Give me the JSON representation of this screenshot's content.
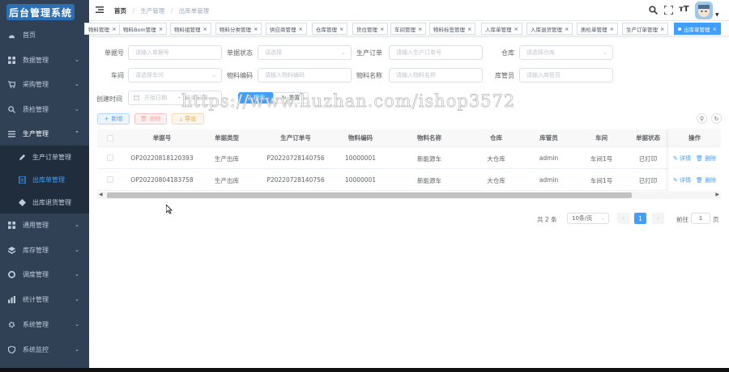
{
  "logo": "后台管理系统",
  "sidebar": {
    "items": [
      {
        "label": "首页",
        "icon": "dashboard-icon"
      },
      {
        "label": "数据管理",
        "icon": "grid-icon"
      },
      {
        "label": "采购管理",
        "icon": "cart-icon"
      },
      {
        "label": "质检管理",
        "icon": "search-icon"
      },
      {
        "label": "生产管理",
        "icon": "list-icon"
      }
    ],
    "sub_items": [
      {
        "label": "生产订单管理",
        "icon": "edit-icon"
      },
      {
        "label": "出库单管理",
        "icon": "doc-icon"
      },
      {
        "label": "出库退货管理",
        "icon": "return-icon"
      }
    ],
    "bottom_items": [
      {
        "label": "通用管理",
        "icon": "grid-icon"
      },
      {
        "label": "库存管理",
        "icon": "box-icon"
      },
      {
        "label": "调度管理",
        "icon": "gear-icon"
      },
      {
        "label": "统计管理",
        "icon": "chart-icon"
      },
      {
        "label": "系统管理",
        "icon": "cog-icon"
      },
      {
        "label": "系统监控",
        "icon": "shield-icon"
      }
    ]
  },
  "breadcrumb": [
    "首页",
    "生产管理",
    "出库单管理"
  ],
  "tags": [
    {
      "label": "物料管理"
    },
    {
      "label": "物料Bom管理"
    },
    {
      "label": "物料组管理"
    },
    {
      "label": "物料分类管理"
    },
    {
      "label": "供应商管理"
    },
    {
      "label": "仓库管理"
    },
    {
      "label": "货位管理"
    },
    {
      "label": "车间管理"
    },
    {
      "label": "物料标签管理"
    },
    {
      "label": "入库单管理"
    },
    {
      "label": "入库退货管理"
    },
    {
      "label": "质检单管理"
    },
    {
      "label": "生产订单管理"
    },
    {
      "label": "出库单管理"
    }
  ],
  "colors": {
    "sidebar_bg": "#304156",
    "submenu_bg": "#1f2d3d",
    "accent": "#409eff",
    "danger": "#f56c6c",
    "warning": "#e6a23c"
  },
  "filters": {
    "row1": [
      {
        "label": "单据号",
        "placeholder": "请输入单据号"
      },
      {
        "label": "单据状态",
        "placeholder": "请选择"
      },
      {
        "label": "生产订单",
        "placeholder": "请输入生产订单号"
      },
      {
        "label": "仓库",
        "placeholder": "请选择仓库"
      }
    ],
    "row2": [
      {
        "label": "车间",
        "placeholder": "请选择车间"
      },
      {
        "label": "物料编码",
        "placeholder": "请输入物料编码"
      },
      {
        "label": "物料名称",
        "placeholder": "请输入物料名称"
      },
      {
        "label": "库管员",
        "placeholder": "请输入库管员"
      }
    ],
    "date_label": "创建时间",
    "date_start": "开始日期",
    "date_sep": "-",
    "date_end": "结束日期",
    "search_btn": "搜索",
    "reset_btn": "重置"
  },
  "toolbar": {
    "add": "新增",
    "delete": "删除",
    "export": "导出"
  },
  "table": {
    "headers": [
      "单据号",
      "单据类型",
      "生产订单号",
      "物料编码",
      "物料名称",
      "仓库",
      "库管员",
      "车间",
      "单据状态",
      "操作"
    ],
    "rows": [
      [
        "OP20220818120393",
        "生产出库",
        "P20220728140756",
        "10000001",
        "新能源车",
        "大仓库",
        "admin",
        "车间1号",
        "已打印"
      ],
      [
        "OP20220804183758",
        "生产出库",
        "P20220728140756",
        "10000001",
        "新能源车",
        "大仓库",
        "admin",
        "车间1号",
        "已打印"
      ]
    ],
    "op_detail": "详情",
    "op_delete": "删除"
  },
  "pagination": {
    "total": "共 2 条",
    "page_size": "10条/页",
    "current": "1",
    "goto_label": "前往",
    "goto_value": "1",
    "page_unit": "页"
  },
  "watermark": "https://www.huzhan.com/ishop3572"
}
